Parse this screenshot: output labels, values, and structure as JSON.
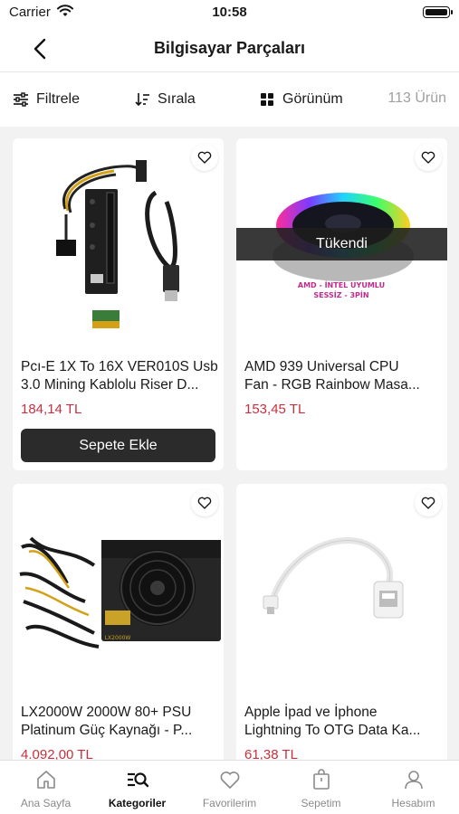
{
  "status": {
    "carrier": "Carrier",
    "time": "10:58"
  },
  "header": {
    "title": "Bilgisayar Parçaları"
  },
  "toolbar": {
    "filter": "Filtrele",
    "sort": "Sırala",
    "view": "Görünüm",
    "count": "113 Ürün"
  },
  "products": [
    {
      "name1": "Pcı-E 1X To 16X VER010S Usb",
      "name2": "3.0 Mining Kablolu Riser D...",
      "price": "184,14 TL",
      "button": "Sepete Ekle"
    },
    {
      "name1": "AMD 939 Universal CPU",
      "name2": "Fan - RGB Rainbow Masa...",
      "price": "153,45 TL",
      "badge": "Tükendi",
      "img_text1": "AMD - İNTEL UYUMLU",
      "img_text2": "SESSİZ - 3PİN"
    },
    {
      "name1": "LX2000W 2000W 80+ PSU",
      "name2": "Platinum Güç Kaynağı - P...",
      "price": "4.092,00 TL",
      "img_label": "LX2000W"
    },
    {
      "name1": "Apple İpad ve İphone",
      "name2": "Lightning To OTG Data Ka...",
      "price": "61,38 TL"
    }
  ],
  "tabs": [
    {
      "label": "Ana Sayfa",
      "icon": "home-icon"
    },
    {
      "label": "Kategoriler",
      "icon": "categories-search-icon"
    },
    {
      "label": "Favorilerim",
      "icon": "heart-icon"
    },
    {
      "label": "Sepetim",
      "icon": "bag-icon"
    },
    {
      "label": "Hesabım",
      "icon": "user-icon"
    }
  ],
  "colors": {
    "price": "#c8303f",
    "button": "#2b2b2b",
    "background": "#f2f2f2"
  }
}
